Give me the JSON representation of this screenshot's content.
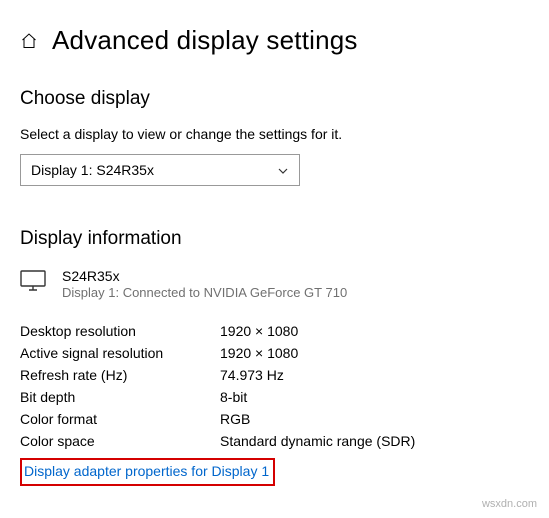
{
  "header": {
    "title": "Advanced display settings"
  },
  "choose_display": {
    "title": "Choose display",
    "description": "Select a display to view or change the settings for it.",
    "selected": "Display 1: S24R35x"
  },
  "display_info": {
    "title": "Display information",
    "monitor_name": "S24R35x",
    "monitor_sub": "Display 1: Connected to NVIDIA GeForce GT 710",
    "rows": [
      {
        "label": "Desktop resolution",
        "value": "1920 × 1080"
      },
      {
        "label": "Active signal resolution",
        "value": "1920 × 1080"
      },
      {
        "label": "Refresh rate (Hz)",
        "value": "74.973 Hz"
      },
      {
        "label": "Bit depth",
        "value": "8-bit"
      },
      {
        "label": "Color format",
        "value": "RGB"
      },
      {
        "label": "Color space",
        "value": "Standard dynamic range (SDR)"
      }
    ],
    "adapter_link": "Display adapter properties for Display 1"
  },
  "watermark": "wsxdn.com"
}
